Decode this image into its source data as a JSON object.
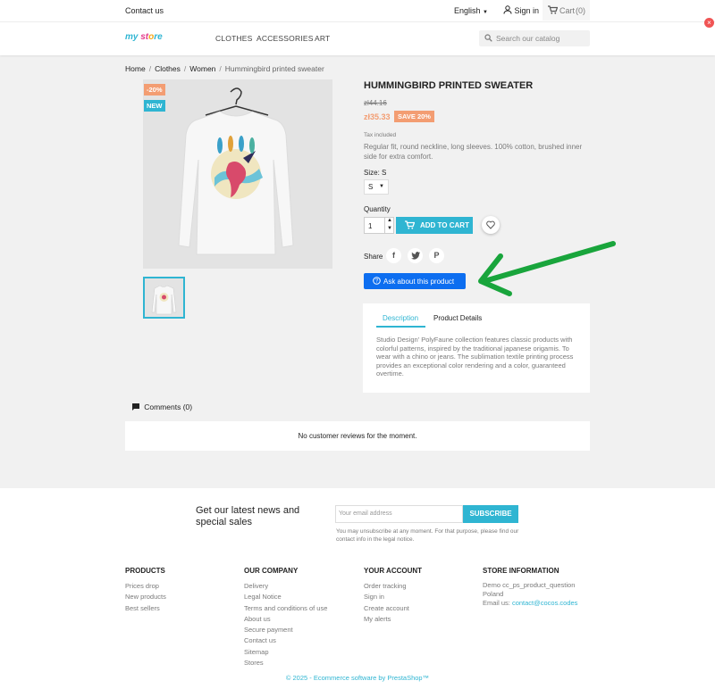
{
  "topbar": {
    "contact": "Contact us",
    "language": "English",
    "signin": "Sign in",
    "cart": "Cart",
    "cart_count": "(0)"
  },
  "header": {
    "logo": "my store",
    "nav": [
      "CLOTHES",
      "ACCESSORIES",
      "ART"
    ],
    "search_placeholder": "Search our catalog"
  },
  "breadcrumb": [
    "Home",
    "Clothes",
    "Women",
    "Hummingbird printed sweater"
  ],
  "product": {
    "badges": [
      "-20%",
      "NEW"
    ],
    "title": "HUMMINGBIRD PRINTED SWEATER",
    "old_price": "zł44.16",
    "price": "zł35.33",
    "save": "SAVE 20%",
    "tax": "Tax included",
    "description_short": "Regular fit, round neckline, long sleeves. 100% cotton, brushed inner side for extra comfort.",
    "size_label": "Size: S",
    "size_value": "S",
    "quantity_label": "Quantity",
    "quantity_value": "1",
    "add_to_cart": "ADD TO CART",
    "share_label": "Share",
    "share_icons": [
      "f",
      "t",
      "P"
    ],
    "ask_button": "Ask about this product"
  },
  "tabs": {
    "items": [
      "Description",
      "Product Details"
    ],
    "description": "Studio Design' PolyFaune collection features classic products with colorful patterns, inspired by the traditional japanese origamis. To wear with a chino or jeans. The sublimation textile printing process provides an exceptional color rendering and a color, guaranteed overtime."
  },
  "comments": {
    "label": "Comments (0)",
    "empty": "No customer reviews for the moment."
  },
  "newsletter": {
    "title_line1": "Get our latest news and",
    "title_line2": "special sales",
    "placeholder": "Your email address",
    "subscribe": "SUBSCRIBE",
    "note_line1": "You may unsubscribe at any moment. For that purpose, please find our",
    "note_line2": "contact info in the legal notice."
  },
  "footer": {
    "products": {
      "title": "PRODUCTS",
      "links": [
        "Prices drop",
        "New products",
        "Best sellers"
      ]
    },
    "company": {
      "title": "OUR COMPANY",
      "links": [
        "Delivery",
        "Legal Notice",
        "Terms and conditions of use",
        "About us",
        "Secure payment",
        "Contact us",
        "Sitemap",
        "Stores"
      ]
    },
    "account": {
      "title": "YOUR ACCOUNT",
      "links": [
        "Order tracking",
        "Sign in",
        "Create account",
        "My alerts"
      ]
    },
    "store": {
      "title": "STORE INFORMATION",
      "line1": "Demo cc_ps_product_question",
      "line2": "Poland",
      "email_label": "Email us:",
      "email": "contact@cocos.codes"
    },
    "copyright": "© 2025 - Ecommerce software by PrestaShop™"
  },
  "colors": {
    "accent": "#2fb5d2",
    "sale": "#f39d72",
    "ask_button": "#0d6ef0",
    "arrow": "#19a53c"
  }
}
